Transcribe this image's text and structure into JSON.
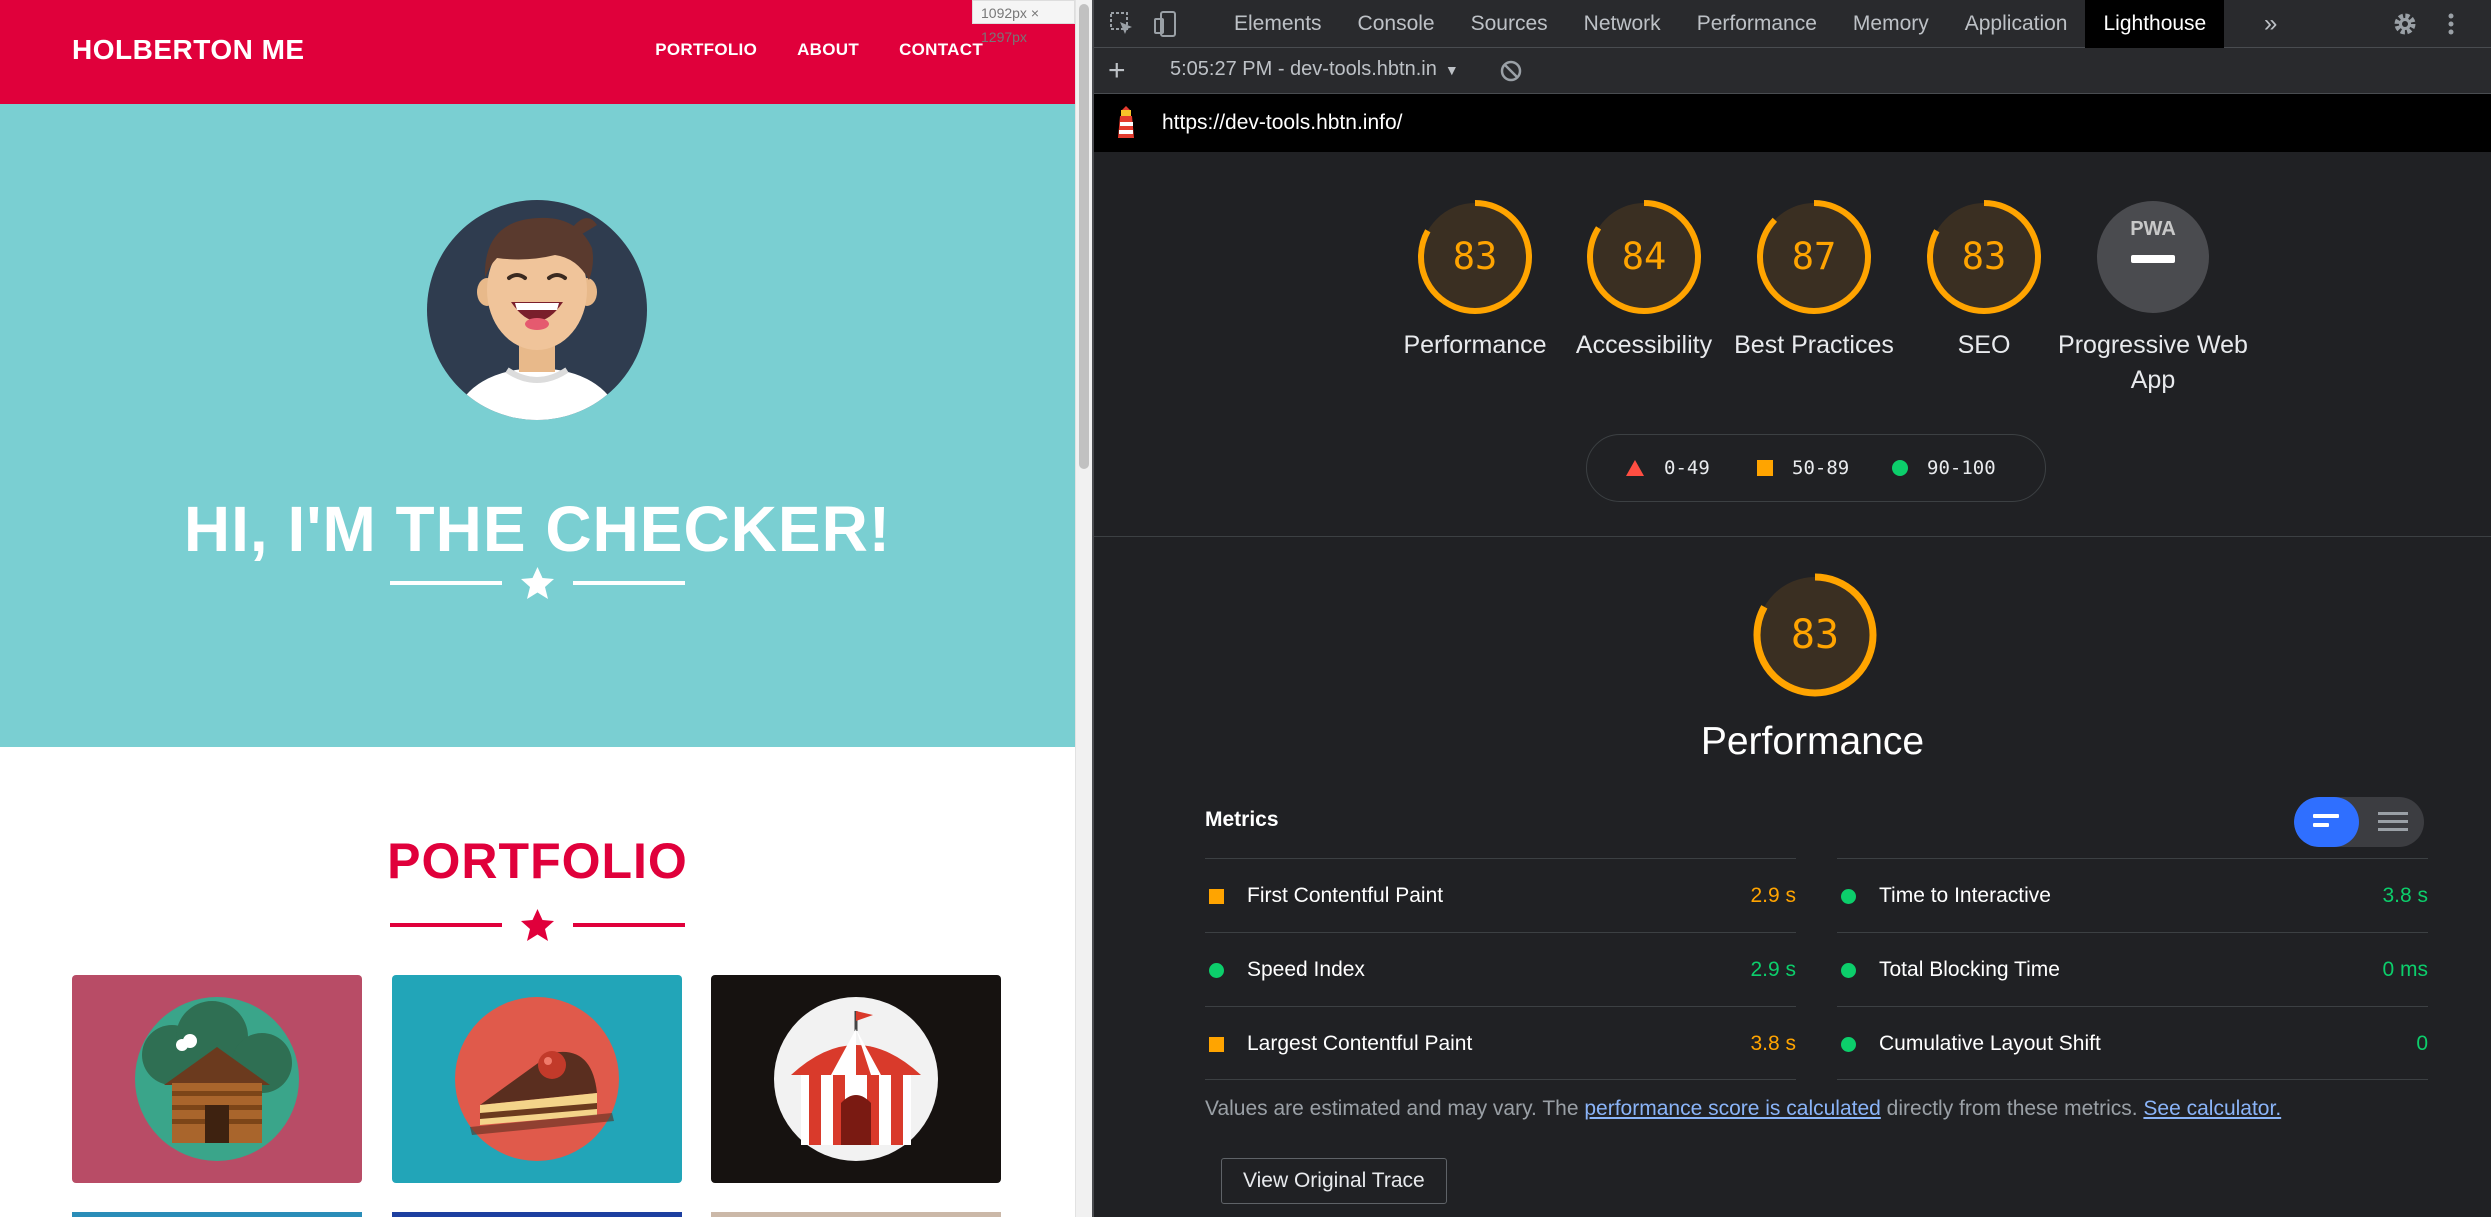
{
  "site": {
    "brand": "HOLBERTON ME",
    "nav": [
      "PORTFOLIO",
      "ABOUT",
      "CONTACT"
    ],
    "size_badge": "1092px × 1297px",
    "hero_title": "HI, I'M THE CHECKER!",
    "portfolio_title": "PORTFOLIO",
    "tiles": [
      {
        "name": "cabin",
        "bg": "#b84c66"
      },
      {
        "name": "cake",
        "bg": "#22a5b8"
      },
      {
        "name": "circus-tent",
        "bg": "#161210"
      }
    ],
    "colors": {
      "nav": "#e0003b",
      "hero": "#7acfd2"
    }
  },
  "devtools": {
    "tabs": [
      "Elements",
      "Console",
      "Sources",
      "Network",
      "Performance",
      "Memory",
      "Application",
      "Lighthouse"
    ],
    "active_tab": "Lighthouse",
    "report_select": "5:05:27 PM - dev-tools.hbtn.in",
    "url": "https://dev-tools.hbtn.info/",
    "gauges": [
      {
        "label": "Performance",
        "score": "83"
      },
      {
        "label": "Accessibility",
        "score": "84"
      },
      {
        "label": "Best Practices",
        "score": "87"
      },
      {
        "label": "SEO",
        "score": "83"
      },
      {
        "label": "Progressive Web App",
        "badge": "PWA"
      }
    ],
    "legend": [
      {
        "shape": "triangle",
        "range": "0-49",
        "color": "#ff4e42"
      },
      {
        "shape": "square",
        "range": "50-89",
        "color": "#ffa400"
      },
      {
        "shape": "circle",
        "range": "90-100",
        "color": "#0cce6b"
      }
    ],
    "performance": {
      "score": "83",
      "title": "Performance",
      "metrics_heading": "Metrics",
      "metrics_left": [
        {
          "name": "First Contentful Paint",
          "value": "2.9 s",
          "status": "average"
        },
        {
          "name": "Speed Index",
          "value": "2.9 s",
          "status": "pass"
        },
        {
          "name": "Largest Contentful Paint",
          "value": "3.8 s",
          "status": "average"
        }
      ],
      "metrics_right": [
        {
          "name": "Time to Interactive",
          "value": "3.8 s",
          "status": "pass"
        },
        {
          "name": "Total Blocking Time",
          "value": "0 ms",
          "status": "pass"
        },
        {
          "name": "Cumulative Layout Shift",
          "value": "0",
          "status": "pass"
        }
      ],
      "note_prefix": "Values are estimated and may vary. The ",
      "note_link": "performance score is calculated",
      "note_middle": " directly from these metrics. ",
      "note_link2": "See calculator.",
      "trace_button": "View Original Trace"
    },
    "colors": {
      "average": "#ffa400",
      "pass": "#0cce6b",
      "fail": "#ff4e42"
    }
  }
}
